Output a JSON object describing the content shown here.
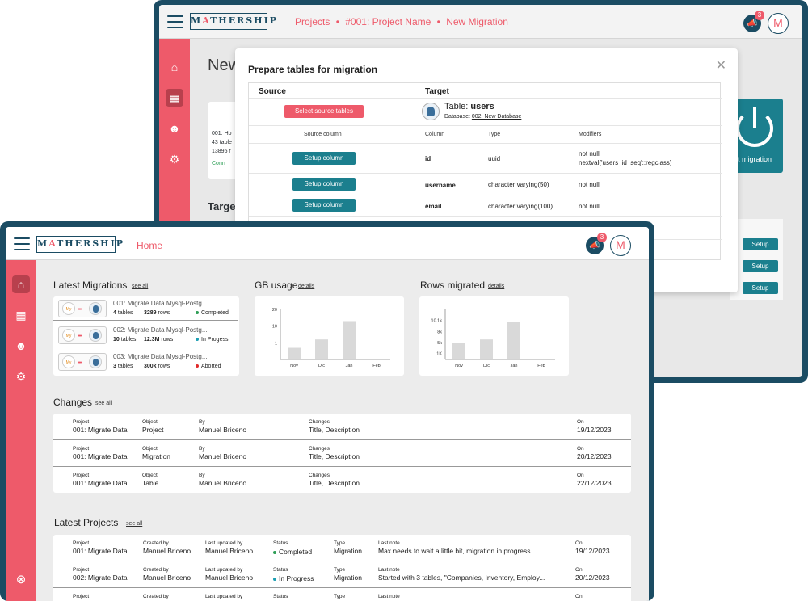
{
  "brand": {
    "logo_text_before": "M",
    "logo_accent": "A",
    "logo_text_after": "THERSHIP"
  },
  "colors": {
    "accent": "#ee5a6a",
    "navy": "#1b4c63",
    "teal": "#1b7f8e"
  },
  "back_window": {
    "breadcrumb": [
      "Projects",
      "#001: Project Name",
      "New Migration"
    ],
    "breadcrumb_sep": "•",
    "page_title_partial": "New",
    "notifications": "3",
    "avatar": "M",
    "left_card": [
      "001: Ho",
      "43 table",
      "13895 r",
      "Conn"
    ],
    "target_label_partial": "Target",
    "power_label_partial": "t migration",
    "setup_label": "Setup",
    "modal": {
      "title": "Prepare tables for migration",
      "source_header": "Source",
      "target_header": "Target",
      "select_source_button": "Select source tables",
      "table_prefix": "Table:",
      "table_name": "users",
      "database_prefix": "Database:",
      "database_name": "002: New Database",
      "col_source_column": "Source column",
      "col_column": "Column",
      "col_type": "Type",
      "col_modifiers": "Modifiers",
      "setup_button": "Setup column",
      "rows": [
        {
          "column": "id",
          "type": "uuid",
          "modifiers": [
            "not null",
            "nextval('users_id_seq'::regclass)"
          ]
        },
        {
          "column": "username",
          "type": "character varying(50)",
          "modifiers": [
            "not null"
          ]
        },
        {
          "column": "email",
          "type": "character varying(100)",
          "modifiers": [
            "not null"
          ]
        }
      ]
    }
  },
  "front_window": {
    "nav_title": "Home",
    "notifications": "3",
    "avatar": "M",
    "see_all": "see all",
    "details": "details",
    "latest_migrations": {
      "title": "Latest Migrations",
      "items": [
        {
          "name": "001: Migrate Data Mysql-Postg...",
          "tables_num": "4",
          "tables_lbl": "tables",
          "rows_num": "3289",
          "rows_lbl": "rows",
          "status": "Completed",
          "status_color": "#2e9e56"
        },
        {
          "name": "002: Migrate Data Mysql-Postg...",
          "tables_num": "10",
          "tables_lbl": "tables",
          "rows_num": "12.3M",
          "rows_lbl": "rows",
          "status": "In Progess",
          "status_color": "#1b9eb3"
        },
        {
          "name": "003: Migrate Data Mysql-Postg...",
          "tables_num": "3",
          "tables_lbl": "tables",
          "rows_num": "300k",
          "rows_lbl": "rows",
          "status": "Aborted",
          "status_color": "#e02a2a"
        }
      ]
    },
    "changes": {
      "title": "Changes",
      "headers": {
        "project": "Project",
        "object": "Object",
        "by": "By",
        "changes": "Changes",
        "on": "On"
      },
      "rows": [
        {
          "project": "001: Migrate Data",
          "object": "Project",
          "by": "Manuel Briceno",
          "changes": "Title, Description",
          "on": "19/12/2023"
        },
        {
          "project": "001: Migrate Data",
          "object": "Migration",
          "by": "Manuel Briceno",
          "changes": "Title, Description",
          "on": "20/12/2023"
        },
        {
          "project": "001: Migrate Data",
          "object": "Table",
          "by": "Manuel Briceno",
          "changes": "Title, Description",
          "on": "22/12/2023"
        }
      ]
    },
    "latest_projects": {
      "title": "Latest Projects",
      "headers": {
        "project": "Project",
        "created_by": "Created by",
        "last_updated_by": "Last updated by",
        "status": "Status",
        "type": "Type",
        "last_note": "Last note",
        "on": "On"
      },
      "rows": [
        {
          "project": "001: Migrate Data",
          "created_by": "Manuel Briceno",
          "last_updated_by": "Manuel Briceno",
          "status": "Completed",
          "status_color": "#2e9e56",
          "type": "Migration",
          "last_note": "Max needs to wait a little bit, migration in progress",
          "on": "19/12/2023"
        },
        {
          "project": "002: Migrate Data",
          "created_by": "Manuel Briceno",
          "last_updated_by": "Manuel Briceno",
          "status": "In Progress",
          "status_color": "#1b9eb3",
          "type": "Migration",
          "last_note": "Started with 3 tables, \"Companies, Inventory, Employ...",
          "on": "20/12/2023"
        }
      ],
      "partial_row_headers": [
        "Project",
        "Created by",
        "Last updated by",
        "Status",
        "Type",
        "Last note",
        "On"
      ]
    }
  },
  "chart_data": [
    {
      "type": "bar",
      "title": "GB usage",
      "categories": [
        "Nov",
        "Dic",
        "Jan",
        "Feb"
      ],
      "values": [
        0.7,
        1.2,
        2.3,
        0
      ],
      "ytick_labels": [
        "1",
        "10",
        "20"
      ],
      "ylim": [
        0,
        3
      ],
      "ticks": [
        1,
        2,
        3
      ]
    },
    {
      "type": "bar",
      "title": "Rows migrated",
      "categories": [
        "Nov",
        "Dic",
        "Jan",
        "Feb"
      ],
      "values": [
        3.3,
        4.0,
        7.5,
        0
      ],
      "ytick_labels": [
        "1K",
        "5k",
        "8k",
        "10.1k"
      ],
      "ylim": [
        0,
        10
      ],
      "ticks": [
        1.2,
        3.4,
        5.6,
        7.8
      ]
    }
  ]
}
